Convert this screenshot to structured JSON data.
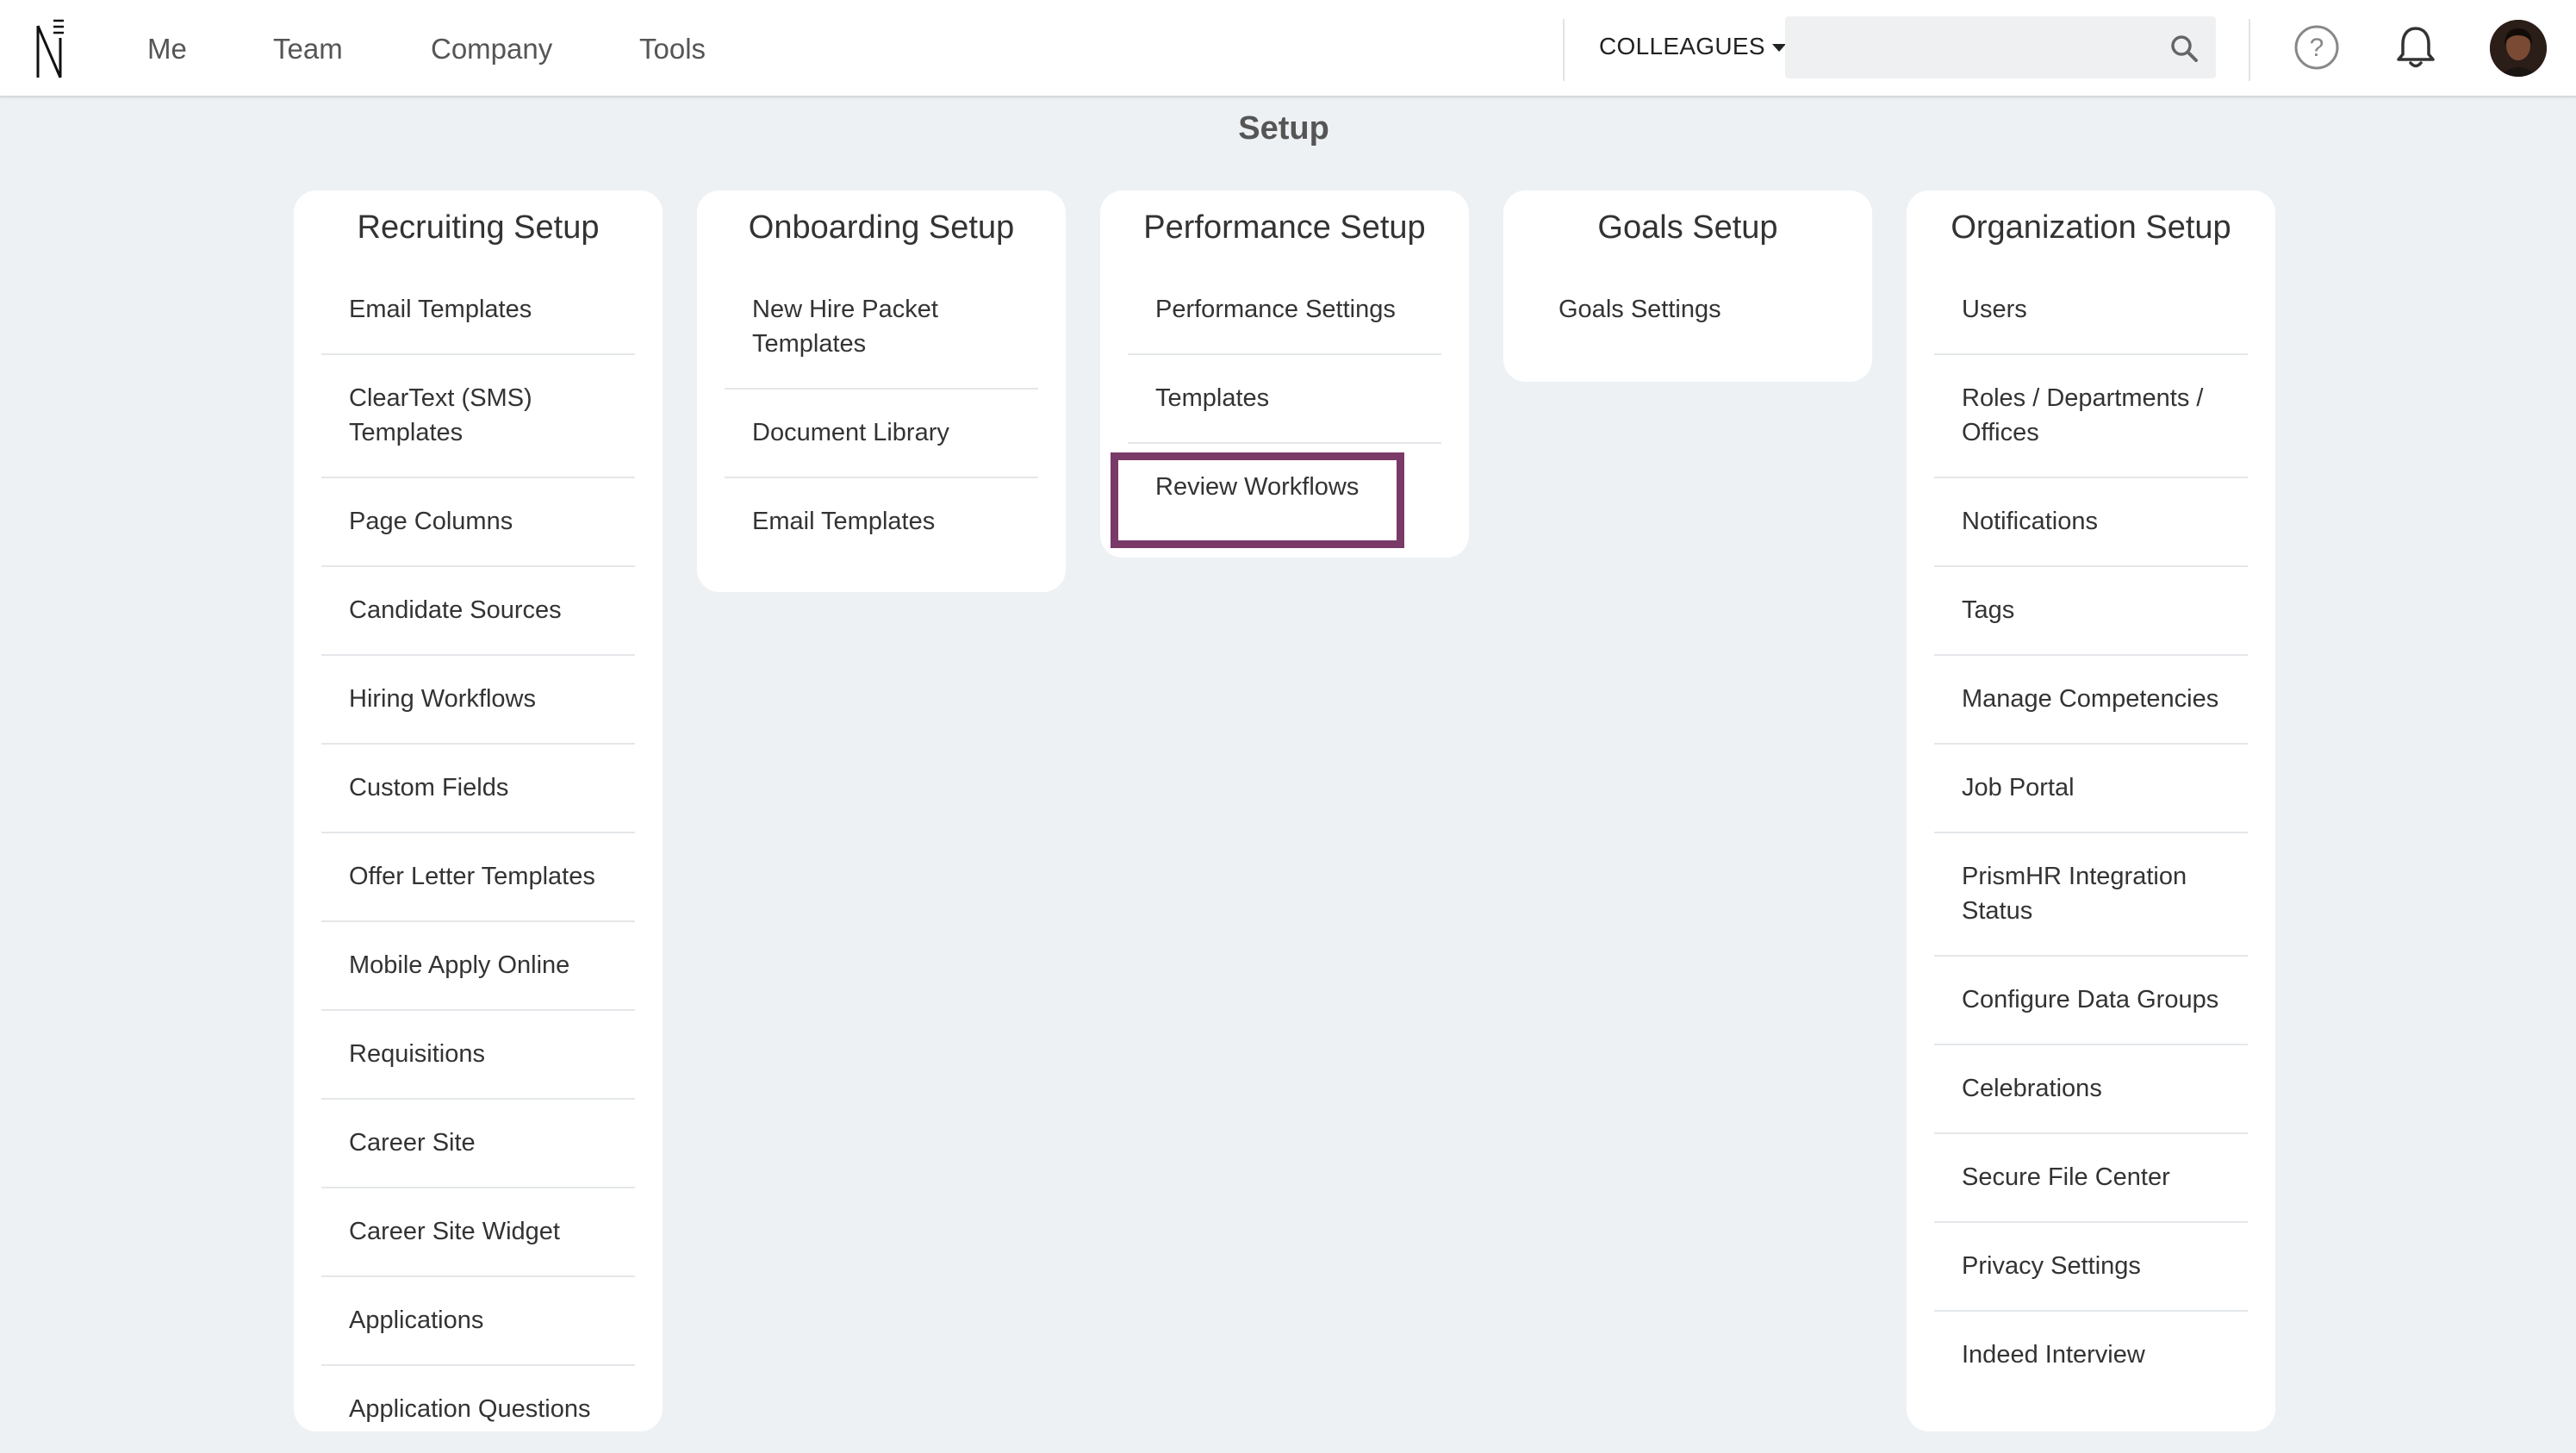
{
  "nav": {
    "items": [
      {
        "label": "Me"
      },
      {
        "label": "Team"
      },
      {
        "label": "Company"
      },
      {
        "label": "Tools"
      }
    ],
    "colleagues_label": "COLLEAGUES",
    "search": {
      "value": "",
      "placeholder": ""
    },
    "icons": [
      "logo-icon",
      "search-icon",
      "help-icon",
      "bell-icon",
      "avatar"
    ]
  },
  "page": {
    "title": "Setup"
  },
  "cards": [
    {
      "title": "Recruiting Setup",
      "items": [
        {
          "label": "Email Templates"
        },
        {
          "label": "ClearText (SMS) Templates"
        },
        {
          "label": "Page Columns"
        },
        {
          "label": "Candidate Sources"
        },
        {
          "label": "Hiring Workflows"
        },
        {
          "label": "Custom Fields"
        },
        {
          "label": "Offer Letter Templates"
        },
        {
          "label": "Mobile Apply Online"
        },
        {
          "label": "Requisitions"
        },
        {
          "label": "Career Site"
        },
        {
          "label": "Career Site Widget"
        },
        {
          "label": "Applications"
        },
        {
          "label": "Application Questions"
        }
      ]
    },
    {
      "title": "Onboarding Setup",
      "items": [
        {
          "label": "New Hire Packet Templates"
        },
        {
          "label": "Document Library"
        },
        {
          "label": "Email Templates"
        }
      ]
    },
    {
      "title": "Performance Setup",
      "items": [
        {
          "label": "Performance Settings"
        },
        {
          "label": "Templates"
        },
        {
          "label": "Review Workflows",
          "highlighted": true
        }
      ]
    },
    {
      "title": "Goals Setup",
      "items": [
        {
          "label": "Goals Settings"
        }
      ]
    },
    {
      "title": "Organization Setup",
      "items": [
        {
          "label": "Users"
        },
        {
          "label": "Roles / Departments / Offices"
        },
        {
          "label": "Notifications"
        },
        {
          "label": "Tags"
        },
        {
          "label": "Manage Competencies"
        },
        {
          "label": "Job Portal"
        },
        {
          "label": "PrismHR Integration Status"
        },
        {
          "label": "Configure Data Groups"
        },
        {
          "label": "Celebrations"
        },
        {
          "label": "Secure File Center"
        },
        {
          "label": "Privacy Settings"
        },
        {
          "label": "Indeed Interview"
        }
      ]
    }
  ],
  "colors": {
    "background": "#eef1f4",
    "card": "#ffffff",
    "highlight": "#7a3a68",
    "divider": "#e4e7ea"
  }
}
